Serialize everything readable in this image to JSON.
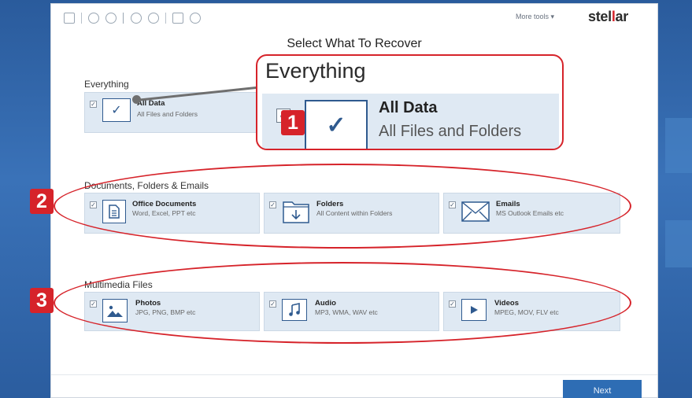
{
  "toolbar": {
    "more_tools_label": "More tools",
    "more_tools_caret": "▾",
    "logo_part1": "stel",
    "logo_highlight": "l",
    "logo_part2": "ar",
    "logo_color": "#d6232a"
  },
  "page_title": "Select What To Recover",
  "everything": {
    "section_label": "Everything",
    "all_data": {
      "title": "All Data",
      "subtitle": "All Files and Folders",
      "checked": true
    }
  },
  "callout": {
    "label": "Everything",
    "title": "All Data",
    "subtitle": "All Files and Folders"
  },
  "documents": {
    "section_label": "Documents, Folders & Emails",
    "items": [
      {
        "title": "Office Documents",
        "subtitle": "Word, Excel, PPT etc",
        "icon": "document-icon"
      },
      {
        "title": "Folders",
        "subtitle": "All Content within Folders",
        "icon": "folder-icon"
      },
      {
        "title": "Emails",
        "subtitle": "MS Outlook Emails etc",
        "icon": "envelope-icon"
      }
    ]
  },
  "multimedia": {
    "section_label": "Multimedia Files",
    "items": [
      {
        "title": "Photos",
        "subtitle": "JPG, PNG, BMP etc",
        "icon": "image-icon"
      },
      {
        "title": "Audio",
        "subtitle": "MP3, WMA, WAV etc",
        "icon": "music-note-icon"
      },
      {
        "title": "Videos",
        "subtitle": "MPEG, MOV, FLV etc",
        "icon": "play-icon"
      }
    ]
  },
  "badges": [
    "1",
    "2",
    "3"
  ],
  "check_glyph": "✓",
  "next_label": "Next",
  "accent_color": "#d6232a",
  "button_color": "#2e6db4"
}
